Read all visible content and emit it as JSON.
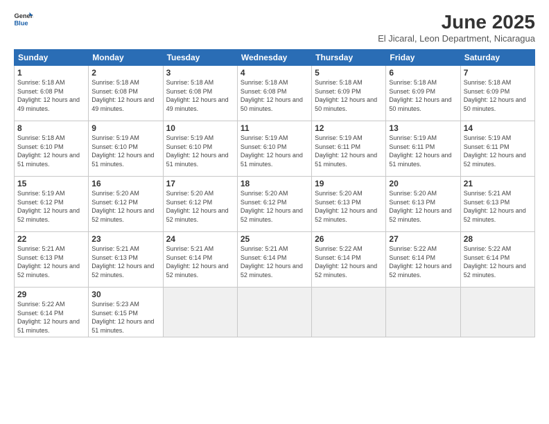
{
  "header": {
    "logo_general": "General",
    "logo_blue": "Blue",
    "month_title": "June 2025",
    "location": "El Jicaral, Leon Department, Nicaragua"
  },
  "calendar": {
    "days_of_week": [
      "Sunday",
      "Monday",
      "Tuesday",
      "Wednesday",
      "Thursday",
      "Friday",
      "Saturday"
    ],
    "weeks": [
      [
        null,
        {
          "day": "2",
          "sunrise": "5:18 AM",
          "sunset": "6:08 PM",
          "daylight": "12 hours and 49 minutes."
        },
        {
          "day": "3",
          "sunrise": "5:18 AM",
          "sunset": "6:08 PM",
          "daylight": "12 hours and 49 minutes."
        },
        {
          "day": "4",
          "sunrise": "5:18 AM",
          "sunset": "6:08 PM",
          "daylight": "12 hours and 50 minutes."
        },
        {
          "day": "5",
          "sunrise": "5:18 AM",
          "sunset": "6:09 PM",
          "daylight": "12 hours and 50 minutes."
        },
        {
          "day": "6",
          "sunrise": "5:18 AM",
          "sunset": "6:09 PM",
          "daylight": "12 hours and 50 minutes."
        },
        {
          "day": "7",
          "sunrise": "5:18 AM",
          "sunset": "6:09 PM",
          "daylight": "12 hours and 50 minutes."
        }
      ],
      [
        {
          "day": "1",
          "sunrise": "5:18 AM",
          "sunset": "6:08 PM",
          "daylight": "12 hours and 49 minutes."
        },
        {
          "day": "9",
          "sunrise": "5:19 AM",
          "sunset": "6:10 PM",
          "daylight": "12 hours and 51 minutes."
        },
        {
          "day": "10",
          "sunrise": "5:19 AM",
          "sunset": "6:10 PM",
          "daylight": "12 hours and 51 minutes."
        },
        {
          "day": "11",
          "sunrise": "5:19 AM",
          "sunset": "6:10 PM",
          "daylight": "12 hours and 51 minutes."
        },
        {
          "day": "12",
          "sunrise": "5:19 AM",
          "sunset": "6:11 PM",
          "daylight": "12 hours and 51 minutes."
        },
        {
          "day": "13",
          "sunrise": "5:19 AM",
          "sunset": "6:11 PM",
          "daylight": "12 hours and 51 minutes."
        },
        {
          "day": "14",
          "sunrise": "5:19 AM",
          "sunset": "6:11 PM",
          "daylight": "12 hours and 52 minutes."
        }
      ],
      [
        {
          "day": "8",
          "sunrise": "5:18 AM",
          "sunset": "6:10 PM",
          "daylight": "12 hours and 51 minutes."
        },
        {
          "day": "16",
          "sunrise": "5:20 AM",
          "sunset": "6:12 PM",
          "daylight": "12 hours and 52 minutes."
        },
        {
          "day": "17",
          "sunrise": "5:20 AM",
          "sunset": "6:12 PM",
          "daylight": "12 hours and 52 minutes."
        },
        {
          "day": "18",
          "sunrise": "5:20 AM",
          "sunset": "6:12 PM",
          "daylight": "12 hours and 52 minutes."
        },
        {
          "day": "19",
          "sunrise": "5:20 AM",
          "sunset": "6:13 PM",
          "daylight": "12 hours and 52 minutes."
        },
        {
          "day": "20",
          "sunrise": "5:20 AM",
          "sunset": "6:13 PM",
          "daylight": "12 hours and 52 minutes."
        },
        {
          "day": "21",
          "sunrise": "5:21 AM",
          "sunset": "6:13 PM",
          "daylight": "12 hours and 52 minutes."
        }
      ],
      [
        {
          "day": "15",
          "sunrise": "5:19 AM",
          "sunset": "6:12 PM",
          "daylight": "12 hours and 52 minutes."
        },
        {
          "day": "23",
          "sunrise": "5:21 AM",
          "sunset": "6:13 PM",
          "daylight": "12 hours and 52 minutes."
        },
        {
          "day": "24",
          "sunrise": "5:21 AM",
          "sunset": "6:14 PM",
          "daylight": "12 hours and 52 minutes."
        },
        {
          "day": "25",
          "sunrise": "5:21 AM",
          "sunset": "6:14 PM",
          "daylight": "12 hours and 52 minutes."
        },
        {
          "day": "26",
          "sunrise": "5:22 AM",
          "sunset": "6:14 PM",
          "daylight": "12 hours and 52 minutes."
        },
        {
          "day": "27",
          "sunrise": "5:22 AM",
          "sunset": "6:14 PM",
          "daylight": "12 hours and 52 minutes."
        },
        {
          "day": "28",
          "sunrise": "5:22 AM",
          "sunset": "6:14 PM",
          "daylight": "12 hours and 52 minutes."
        }
      ],
      [
        {
          "day": "22",
          "sunrise": "5:21 AM",
          "sunset": "6:13 PM",
          "daylight": "12 hours and 52 minutes."
        },
        {
          "day": "30",
          "sunrise": "5:23 AM",
          "sunset": "6:15 PM",
          "daylight": "12 hours and 51 minutes."
        },
        null,
        null,
        null,
        null,
        null
      ],
      [
        {
          "day": "29",
          "sunrise": "5:22 AM",
          "sunset": "6:14 PM",
          "daylight": "12 hours and 51 minutes."
        },
        null,
        null,
        null,
        null,
        null,
        null
      ]
    ]
  }
}
